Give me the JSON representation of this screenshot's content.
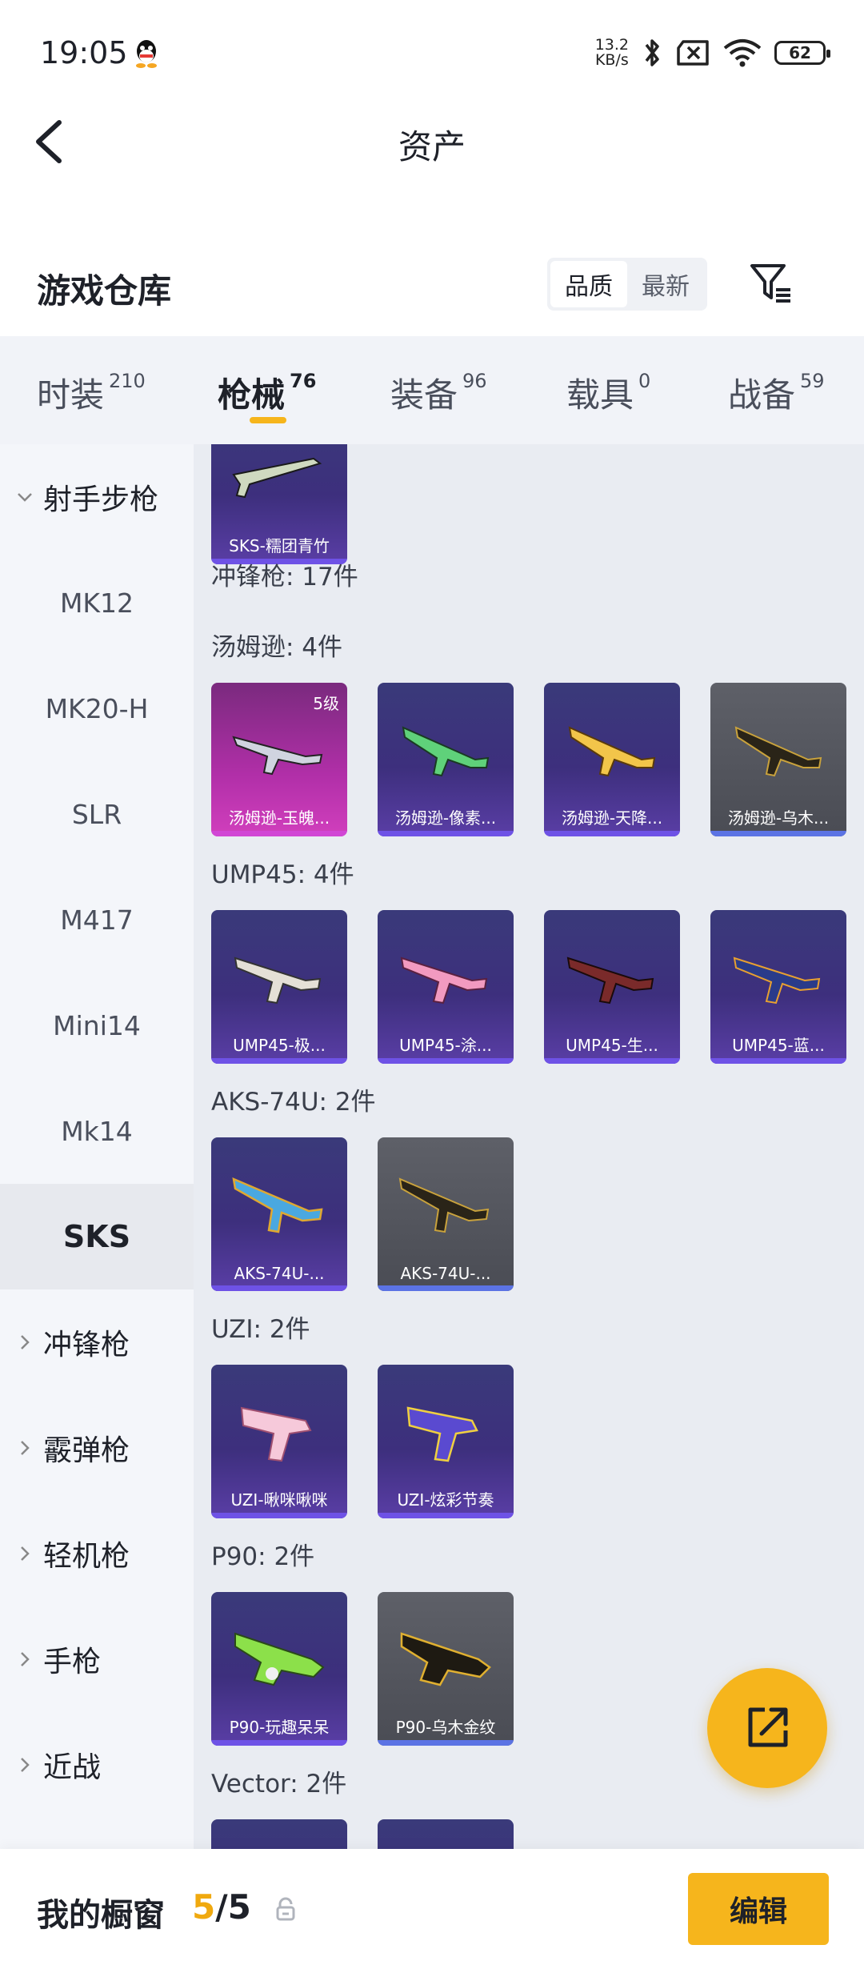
{
  "status": {
    "time": "19:05",
    "net_speed_value": "13.2",
    "net_speed_unit": "KB/s",
    "battery": "62",
    "icons": [
      "qq-icon",
      "bluetooth-icon",
      "sim-off-icon",
      "wifi-icon",
      "battery-icon"
    ]
  },
  "header": {
    "title": "资产",
    "back_icon": "back-chevron-icon"
  },
  "warehouse": {
    "title": "游戏仓库",
    "sort_options": [
      "品质",
      "最新"
    ],
    "sort_active": "品质",
    "filter_icon": "filter-icon"
  },
  "tabs": [
    {
      "label": "时装",
      "count": "210"
    },
    {
      "label": "枪械",
      "count": "76",
      "active": true
    },
    {
      "label": "装备",
      "count": "96"
    },
    {
      "label": "载具",
      "count": "0"
    },
    {
      "label": "战备",
      "count": "59"
    }
  ],
  "sidebar": {
    "expanded_group": "射手步枪",
    "sub_items": [
      "MK12",
      "MK20-H",
      "SLR",
      "M417",
      "Mini14",
      "Mk14",
      "SKS"
    ],
    "selected": "SKS",
    "collapsed_groups": [
      "冲锋枪",
      "霰弹枪",
      "轻机枪",
      "手枪",
      "近战"
    ]
  },
  "content": {
    "top_card": {
      "name": "SKS-糯团青竹"
    },
    "smg_header": "冲锋枪: 17件",
    "groups": [
      {
        "label": "汤姆逊: 4件",
        "items": [
          {
            "name": "汤姆逊-玉魄...",
            "level": "5级"
          },
          {
            "name": "汤姆逊-像素..."
          },
          {
            "name": "汤姆逊-天降..."
          },
          {
            "name": "汤姆逊-乌木..."
          }
        ]
      },
      {
        "label": "UMP45: 4件",
        "items": [
          {
            "name": "UMP45-极..."
          },
          {
            "name": "UMP45-涂..."
          },
          {
            "name": "UMP45-生..."
          },
          {
            "name": "UMP45-蓝..."
          }
        ]
      },
      {
        "label": "AKS-74U: 2件",
        "items": [
          {
            "name": "AKS-74U-..."
          },
          {
            "name": "AKS-74U-..."
          }
        ]
      },
      {
        "label": "UZI: 2件",
        "items": [
          {
            "name": "UZI-啾咪啾咪"
          },
          {
            "name": "UZI-炫彩节奏"
          }
        ]
      },
      {
        "label": "P90: 2件",
        "items": [
          {
            "name": "P90-玩趣呆呆"
          },
          {
            "name": "P90-乌木金纹"
          }
        ]
      },
      {
        "label": "Vector: 2件"
      }
    ],
    "colors": {
      "purple_card": "#3d2f7d",
      "pink_card": "#b12fa8",
      "gray_card": "#4a4c54",
      "accent": "#f6b51c"
    }
  },
  "bottom": {
    "title": "我的橱窗",
    "current": "5",
    "separator": "/",
    "total": "5",
    "edit_label": "编辑"
  }
}
